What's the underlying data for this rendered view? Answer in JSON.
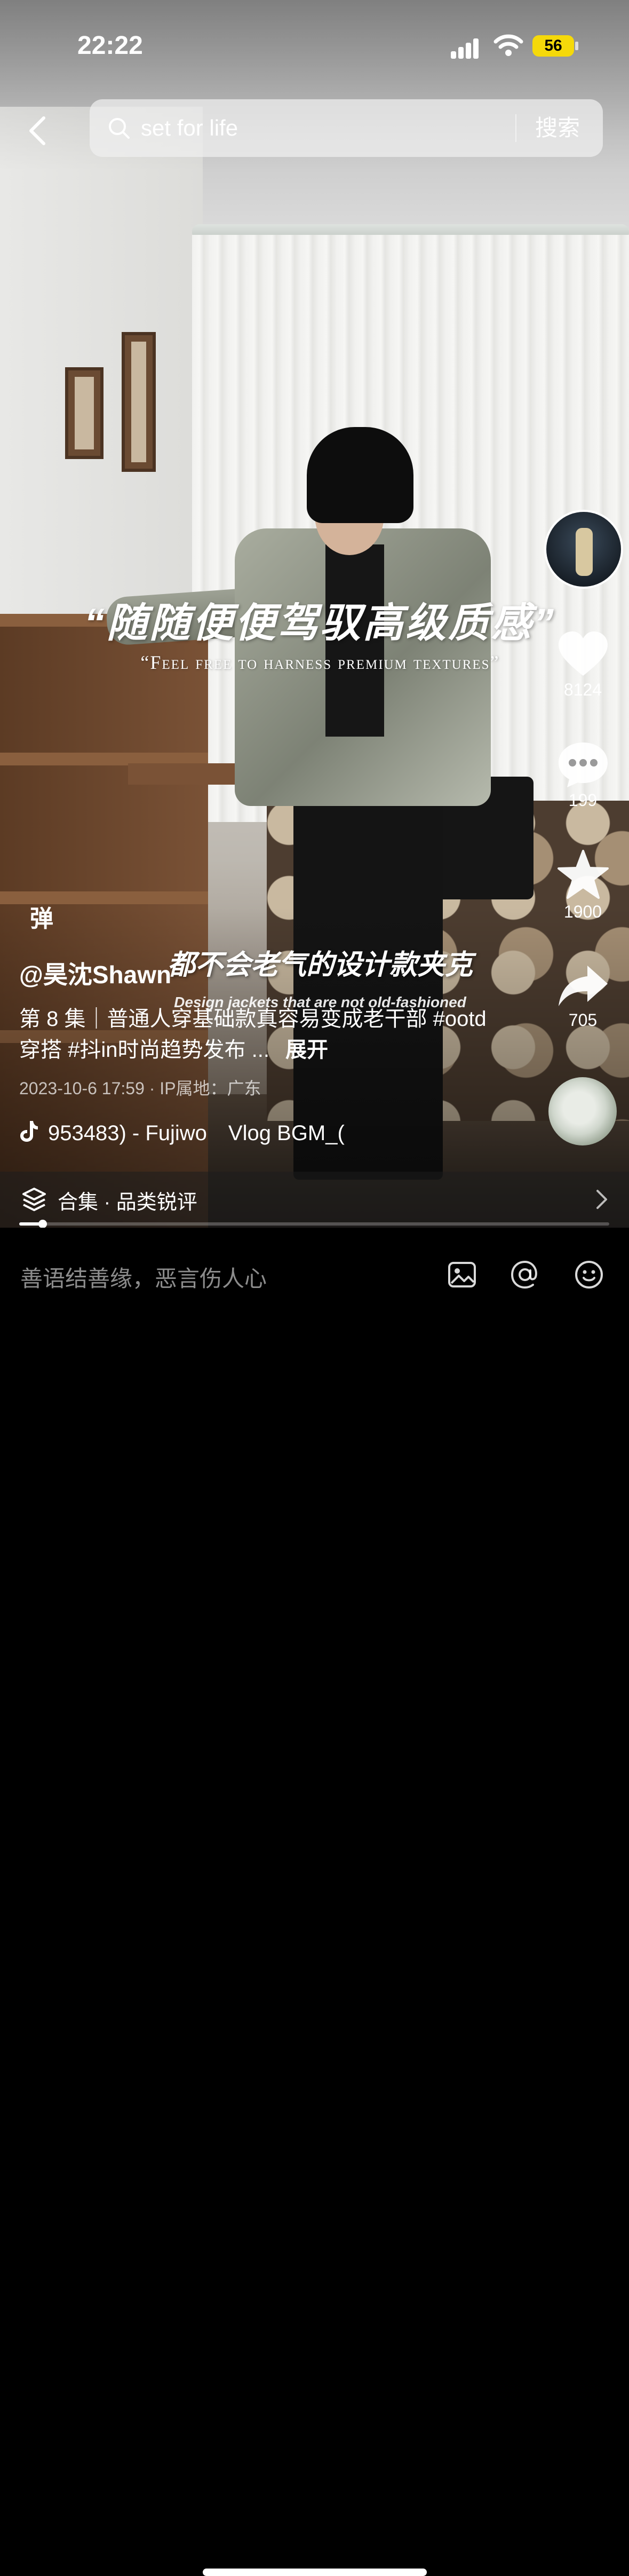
{
  "status_bar": {
    "time": "22:22",
    "battery": "56"
  },
  "search": {
    "query": "set for life",
    "button_label": "搜索"
  },
  "video_text": {
    "caption_cn": "“随随便便驾驭高级质感”",
    "caption_en": "“Feel free to harness premium textures”",
    "subtitle_cn": "都不会老气的设计款夹克",
    "subtitle_en": "Design jackets that are not old-fashioned"
  },
  "side_actions": {
    "likes": "8124",
    "comments": "199",
    "favorites": "1900",
    "shares": "705"
  },
  "danmaku_label": "弹",
  "post": {
    "author": "@昊沈Shawn",
    "description": "第 8 集｜普通人穿基础款真容易变成老干部 #ootd穿搭 #抖in时尚趋势发布 ...",
    "expand_label": "展开",
    "meta": "2023-10-6 17:59 · IP属地：广东",
    "music": "953483) - Fujiwo　Vlog BGM_("
  },
  "collection": {
    "label": "合集 · 品类锐评"
  },
  "progress": {
    "fraction": 0.04
  },
  "comment_bar": {
    "placeholder": "善语结善缘，恶言伤人心"
  },
  "icons": {
    "back": "chevron-left-icon",
    "search": "search-icon",
    "like": "heart-icon",
    "comment": "comment-icon",
    "favorite": "star-icon",
    "share": "share-icon",
    "music": "tiktok-note-icon",
    "collection": "layers-icon",
    "image": "image-icon",
    "mention": "at-icon",
    "emoji": "emoji-icon"
  }
}
